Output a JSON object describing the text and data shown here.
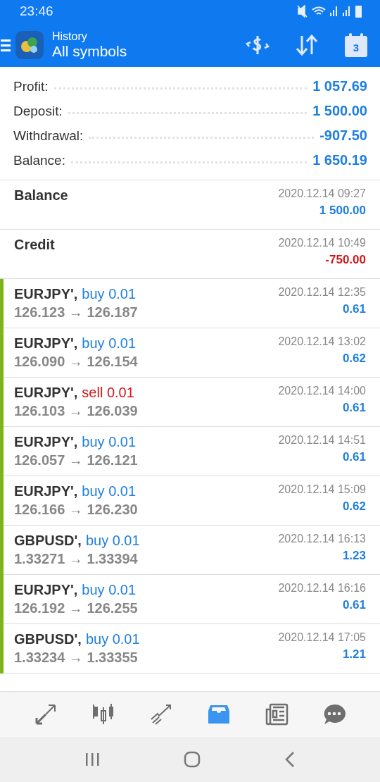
{
  "status_bar": {
    "time": "23:46"
  },
  "app_bar": {
    "title": "History",
    "subtitle": "All symbols",
    "calendar_day": "3"
  },
  "summary": [
    {
      "label": "Profit:",
      "value": "1 057.69"
    },
    {
      "label": "Deposit:",
      "value": "1 500.00"
    },
    {
      "label": "Withdrawal:",
      "value": "-907.50"
    },
    {
      "label": "Balance:",
      "value": "1 650.19"
    }
  ],
  "operations": [
    {
      "kind": "operation",
      "title": "Balance",
      "time": "2020.12.14 09:27",
      "amount": "1 500.00",
      "negative": false
    },
    {
      "kind": "operation",
      "title": "Credit",
      "time": "2020.12.14 10:49",
      "amount": "-750.00",
      "negative": true
    },
    {
      "kind": "trade",
      "symbol": "EURJPY',",
      "side": "buy",
      "volume": "0.01",
      "prices": "126.123 → 126.187",
      "time": "2020.12.14 12:35",
      "amount": "0.61",
      "negative": false
    },
    {
      "kind": "trade",
      "symbol": "EURJPY',",
      "side": "buy",
      "volume": "0.01",
      "prices": "126.090 → 126.154",
      "time": "2020.12.14 13:02",
      "amount": "0.62",
      "negative": false
    },
    {
      "kind": "trade",
      "symbol": "EURJPY',",
      "side": "sell",
      "volume": "0.01",
      "prices": "126.103 → 126.039",
      "time": "2020.12.14 14:00",
      "amount": "0.61",
      "negative": false
    },
    {
      "kind": "trade",
      "symbol": "EURJPY',",
      "side": "buy",
      "volume": "0.01",
      "prices": "126.057 → 126.121",
      "time": "2020.12.14 14:51",
      "amount": "0.61",
      "negative": false
    },
    {
      "kind": "trade",
      "symbol": "EURJPY',",
      "side": "buy",
      "volume": "0.01",
      "prices": "126.166 → 126.230",
      "time": "2020.12.14 15:09",
      "amount": "0.62",
      "negative": false
    },
    {
      "kind": "trade",
      "symbol": "GBPUSD',",
      "side": "buy",
      "volume": "0.01",
      "prices": "1.33271 → 1.33394",
      "time": "2020.12.14 16:13",
      "amount": "1.23",
      "negative": false
    },
    {
      "kind": "trade",
      "symbol": "EURJPY',",
      "side": "buy",
      "volume": "0.01",
      "prices": "126.192 → 126.255",
      "time": "2020.12.14 16:16",
      "amount": "0.61",
      "negative": false
    },
    {
      "kind": "trade",
      "symbol": "GBPUSD',",
      "side": "buy",
      "volume": "0.01",
      "prices": "1.33234 → 1.33355",
      "time": "2020.12.14 17:05",
      "amount": "1.21",
      "negative": false
    }
  ],
  "bottom_nav": [
    {
      "kind": "trade",
      "selected": false
    },
    {
      "kind": "quotes",
      "selected": false
    },
    {
      "kind": "chart",
      "selected": false
    },
    {
      "kind": "history",
      "selected": true
    },
    {
      "kind": "news",
      "selected": false
    },
    {
      "kind": "chat",
      "selected": false
    }
  ]
}
